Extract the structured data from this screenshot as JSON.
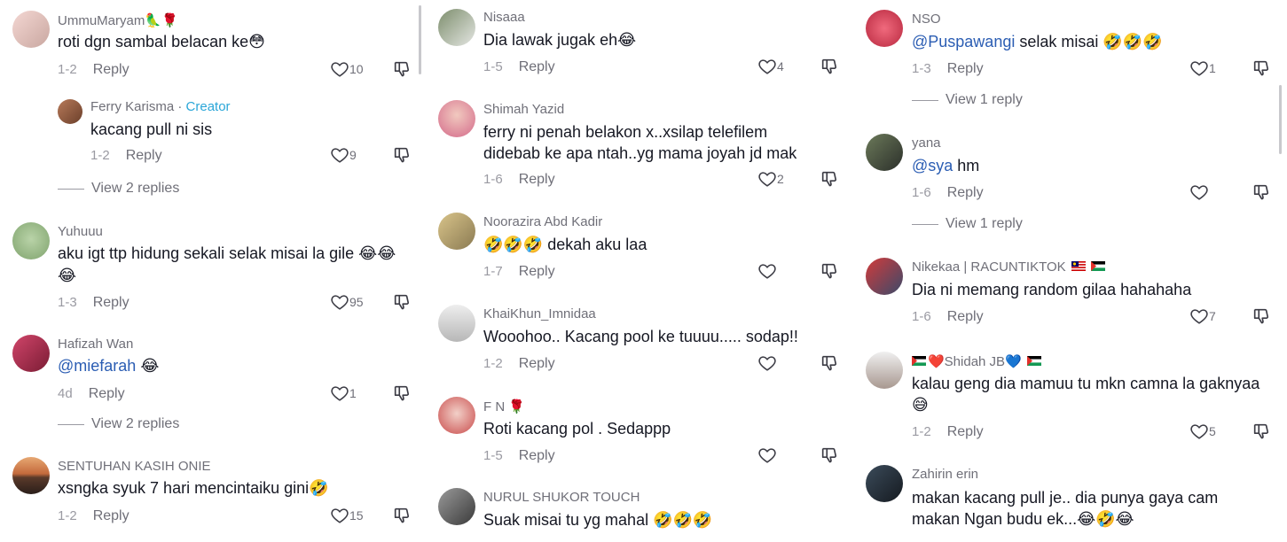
{
  "columns": [
    {
      "comments": [
        {
          "user": "UmmuMaryam🦜🌹",
          "text": "roti dgn sambal belacan ke😳",
          "time": "1-2",
          "reply": "Reply",
          "likes": "10"
        },
        {
          "user": "Ferry Karisma",
          "badge": "Creator",
          "text": "kacang pull ni sis",
          "time": "1-2",
          "reply": "Reply",
          "likes": "9",
          "view_replies": "View 2 replies"
        },
        {
          "user": "Yuhuuu",
          "text": "aku igt ttp hidung sekali selak misai la gile 😂😂",
          "text2": "😂",
          "time": "1-3",
          "reply": "Reply",
          "likes": "95"
        },
        {
          "user": "Hafizah Wan",
          "mention": "@miefarah",
          "text": " 😂",
          "time": "4d",
          "reply": "Reply",
          "likes": "1",
          "view_replies": "View 2 replies"
        },
        {
          "user": "SENTUHAN KASIH ONIE",
          "text": "xsngka syuk 7 hari mencintaiku gini🤣",
          "time": "1-2",
          "reply": "Reply",
          "likes": "15"
        }
      ]
    },
    {
      "comments": [
        {
          "user": "Nisaaa",
          "text": "Dia lawak jugak eh😂",
          "time": "1-5",
          "reply": "Reply",
          "likes": "4"
        },
        {
          "user": "Shimah Yazid",
          "text": "ferry ni penah belakon x..xsilap telefilem",
          "text2": "didebab ke apa ntah..yg mama joyah jd mak",
          "time": "1-6",
          "reply": "Reply",
          "likes": "2"
        },
        {
          "user": "Noorazira Abd Kadir",
          "text": "🤣🤣🤣 dekah aku laa",
          "time": "1-7",
          "reply": "Reply",
          "likes": ""
        },
        {
          "user": "KhaiKhun_Imnidaa",
          "text": "Wooohoo.. Kacang pool ke tuuuu..... sodap!!",
          "time": "1-2",
          "reply": "Reply",
          "likes": ""
        },
        {
          "user": "F N 🌹",
          "text": "Roti kacang pol . Sedappp",
          "time": "1-5",
          "reply": "Reply",
          "likes": ""
        },
        {
          "user": "NURUL SHUKOR TOUCH",
          "text": "Suak misai tu yg mahal 🤣🤣🤣"
        }
      ]
    },
    {
      "comments": [
        {
          "user": "NSO",
          "mention": "@Puspawangi",
          "text": " selak misai 🤣🤣🤣",
          "time": "1-3",
          "reply": "Reply",
          "likes": "1",
          "view_replies": "View 1 reply"
        },
        {
          "user": "yana",
          "mention": "@sya",
          "text": " hm",
          "time": "1-6",
          "reply": "Reply",
          "likes": "",
          "view_replies": "View 1 reply"
        },
        {
          "user": "Nikekaa | RACUNTIKTOK",
          "text": "Dia ni memang random gilaa hahahaha",
          "time": "1-6",
          "reply": "Reply",
          "likes": "7"
        },
        {
          "user": "❤️Shidah JB💙",
          "text": "kalau geng dia mamuu tu mkn camna la gaknyaa",
          "text2": "😅",
          "time": "1-2",
          "reply": "Reply",
          "likes": "5"
        },
        {
          "user": "Zahirin erin",
          "text": "makan kacang pull je.. dia punya gaya cam",
          "text2": "makan Ngan budu ek...😂🤣😂"
        }
      ]
    }
  ],
  "icons": {
    "like": "heart-outline-icon",
    "dislike": "thumbs-down-icon"
  },
  "colors": {
    "mention": "#2b5db3",
    "creator": "#2aa6d8",
    "muted": "#9a9aa2"
  }
}
